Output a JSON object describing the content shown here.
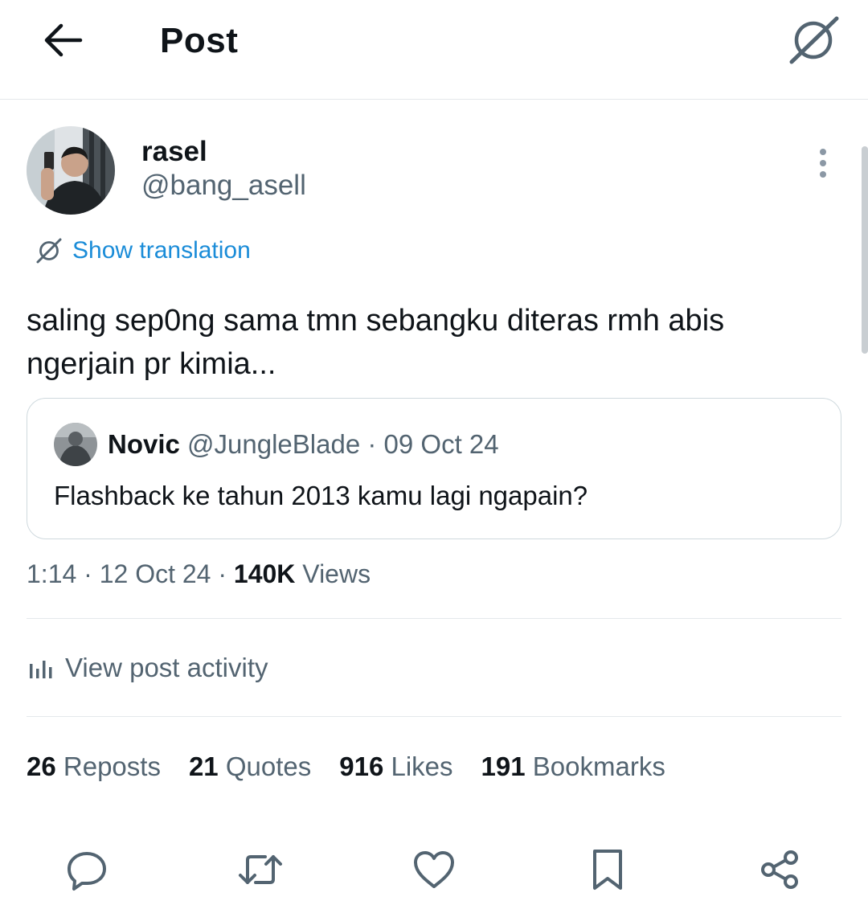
{
  "header": {
    "title": "Post",
    "back_icon": "arrow-left-icon",
    "grok_icon": "grok-icon"
  },
  "post": {
    "author": {
      "display_name": "rasel",
      "handle": "@bang_asell"
    },
    "translate_label": "Show translation",
    "text": "saling sep0ng sama tmn sebangku diteras rmh abis ngerjain pr kimia...",
    "quoted": {
      "name": "Novic",
      "handle": "@JungleBlade",
      "separator": "·",
      "date": "09 Oct 24",
      "text": "Flashback ke tahun 2013 kamu lagi ngapain?"
    },
    "time": "1:14",
    "separator": "·",
    "date": "12 Oct 24",
    "views_count": "140K",
    "views_label": "Views"
  },
  "activity": {
    "label": "View post activity",
    "icon": "analytics-icon"
  },
  "stats": [
    {
      "count": "26",
      "label": "Reposts"
    },
    {
      "count": "21",
      "label": "Quotes"
    },
    {
      "count": "916",
      "label": "Likes"
    },
    {
      "count": "191",
      "label": "Bookmarks"
    }
  ],
  "actions": [
    "reply-icon",
    "repost-icon",
    "like-icon",
    "bookmark-icon",
    "share-icon"
  ],
  "colors": {
    "text": "#0f1419",
    "secondary": "#536471",
    "link": "#1a8cd8",
    "border": "#cfd9de"
  }
}
